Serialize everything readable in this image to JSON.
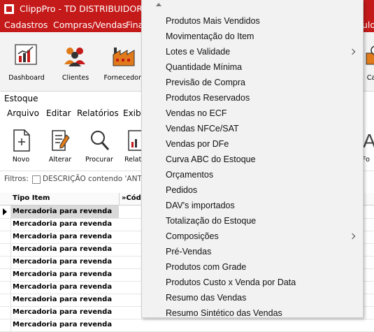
{
  "window": {
    "title": "ClippPro - TD  DISTRIBUIDORA -"
  },
  "main_menu": [
    "Cadastros",
    "Compras/Vendas",
    "Fina",
    "ulos"
  ],
  "main_toolbar": [
    {
      "label": "Dashboard",
      "icon": "dashboard-chart-icon"
    },
    {
      "label": "Clientes",
      "icon": "clients-icon"
    },
    {
      "label": "Fornecedore",
      "icon": "factory-icon"
    },
    {
      "label": "Caixa",
      "icon": "cash-register-icon"
    }
  ],
  "estoque": {
    "title": "Estoque",
    "menu": [
      "Arquivo",
      "Editar",
      "Relatórios",
      "Exibi"
    ],
    "toolbar": [
      {
        "label": "Novo",
        "icon": "new-document-icon"
      },
      {
        "label": "Alterar",
        "icon": "edit-document-icon"
      },
      {
        "label": "Procurar",
        "icon": "magnifier-icon"
      },
      {
        "label": "Relat",
        "icon": "report-icon"
      },
      {
        "label": "Fo",
        "icon": "font-icon"
      }
    ],
    "filter_label": "Filtros:",
    "filter_text": "DESCRIÇÃO contendo 'ANTEN",
    "grid": {
      "columns": [
        "Tipo Item",
        "»Códi"
      ],
      "rows": [
        "Mercadoria para revenda",
        "Mercadoria para revenda",
        "Mercadoria para revenda",
        "Mercadoria para revenda",
        "Mercadoria para revenda",
        "Mercadoria para revenda",
        "Mercadoria para revenda",
        "Mercadoria para revenda",
        "Mercadoria para revenda",
        "Mercadoria para revenda"
      ]
    }
  },
  "popup_menu": [
    {
      "label": "Produtos Mais Vendidos",
      "submenu": false
    },
    {
      "label": "Movimentação do Item",
      "submenu": false
    },
    {
      "label": "Lotes e Validade",
      "submenu": true
    },
    {
      "label": "Quantidade Mínima",
      "submenu": false
    },
    {
      "label": "Previsão de Compra",
      "submenu": false
    },
    {
      "label": "Produtos Reservados",
      "submenu": false
    },
    {
      "label": "Vendas no ECF",
      "submenu": false
    },
    {
      "label": "Vendas NFCe/SAT",
      "submenu": false
    },
    {
      "label": "Vendas por DFe",
      "submenu": false
    },
    {
      "label": "Curva ABC do Estoque",
      "submenu": false
    },
    {
      "label": "Orçamentos",
      "submenu": false
    },
    {
      "label": "Pedidos",
      "submenu": false
    },
    {
      "label": "DAV's importados",
      "submenu": false
    },
    {
      "label": "Totalização do Estoque",
      "submenu": false
    },
    {
      "label": "Composições",
      "submenu": true
    },
    {
      "label": "Pré-Vendas",
      "submenu": false
    },
    {
      "label": "Produtos com Grade",
      "submenu": false
    },
    {
      "label": "Produtos Custo x Venda por Data",
      "submenu": false
    },
    {
      "label": "Resumo das Vendas",
      "submenu": false
    },
    {
      "label": "Resumo Sintético das Vendas",
      "submenu": false
    }
  ],
  "colors": {
    "brand": "#c51a1a",
    "menu_bg": "#f2f2f2",
    "selected_row": "#d9d9d9"
  }
}
